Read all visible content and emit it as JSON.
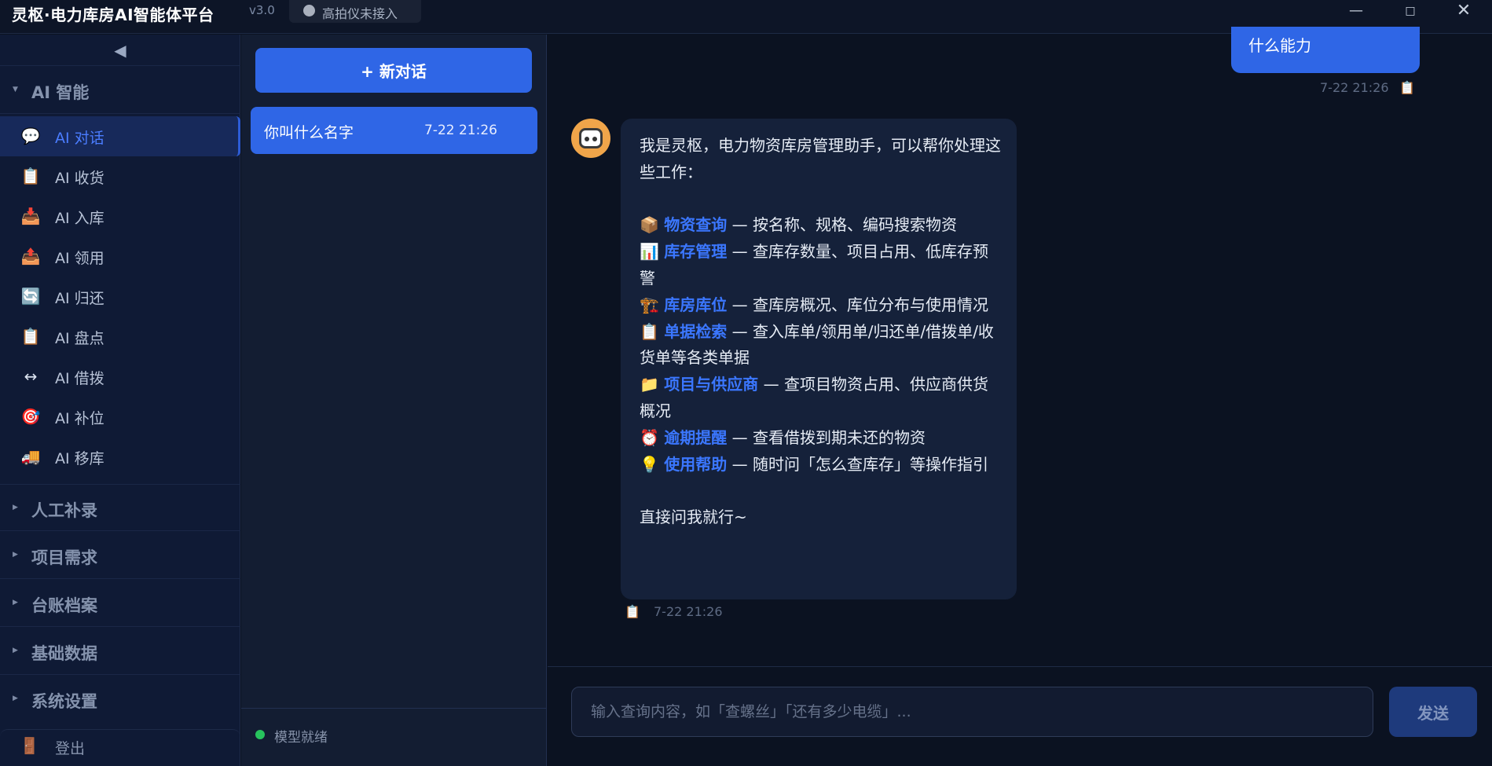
{
  "app": {
    "title": "灵枢·电力库房AI智能体平台",
    "version": "v3.0",
    "device_status": "高拍仪未接入",
    "window_controls": {
      "minimize": "—",
      "maximize": "□",
      "close": "✕"
    }
  },
  "sidebar": {
    "collapse_glyph": "◀",
    "ai_group": {
      "label": "AI 智能",
      "items": [
        {
          "label": "AI 对话",
          "icon": "💬",
          "active": true
        },
        {
          "label": "AI 收货",
          "icon": "📋"
        },
        {
          "label": "AI 入库",
          "icon": "📥"
        },
        {
          "label": "AI 领用",
          "icon": "📤"
        },
        {
          "label": "AI 归还",
          "icon": "🔄"
        },
        {
          "label": "AI 盘点",
          "icon": "📋"
        },
        {
          "label": "AI 借拨",
          "icon": "↔"
        },
        {
          "label": "AI 补位",
          "icon": "🎯"
        },
        {
          "label": "AI 移库",
          "icon": "🚚"
        }
      ]
    },
    "groups": [
      {
        "label": "人工补录"
      },
      {
        "label": "项目需求"
      },
      {
        "label": "台账档案"
      },
      {
        "label": "基础数据"
      },
      {
        "label": "系统设置"
      }
    ],
    "logout": {
      "label": "登出",
      "icon": "🚪"
    }
  },
  "conversations": {
    "new_chat_label": "+ 新对话",
    "items": [
      {
        "title": "你叫什么名字",
        "time": "7-22 21:26"
      }
    ],
    "model_status": "模型就绪"
  },
  "chat": {
    "user_message": {
      "text": "什么能力",
      "time": "7-22 21:26"
    },
    "bot_message": {
      "intro": "我是灵枢，电力物资库房管理助手，可以帮你处理这些工作：",
      "features": [
        {
          "icon": "📦",
          "name": "物资查询",
          "desc": " — 按名称、规格、编码搜索物资"
        },
        {
          "icon": "📊",
          "name": "库存管理",
          "desc": " — 查库存数量、项目占用、低库存预警"
        },
        {
          "icon": "🏗️",
          "name": "库房库位",
          "desc": " — 查库房概况、库位分布与使用情况"
        },
        {
          "icon": "📋",
          "name": "单据检索",
          "desc": " — 查入库单/领用单/归还单/借拨单/收货单等各类单据"
        },
        {
          "icon": "📁",
          "name": "项目与供应商",
          "desc": " — 查项目物资占用、供应商供货概况"
        },
        {
          "icon": "⏰",
          "name": "逾期提醒",
          "desc": " — 查看借拨到期未还的物资"
        },
        {
          "icon": "💡",
          "name": "使用帮助",
          "desc": " — 随时问「怎么查库存」等操作指引"
        }
      ],
      "outro": "直接问我就行~",
      "time": "7-22 21:26"
    },
    "input_placeholder": "输入查询内容，如「查螺丝」「还有多少电缆」...",
    "send_label": "发送",
    "copy_icon": "📋"
  }
}
